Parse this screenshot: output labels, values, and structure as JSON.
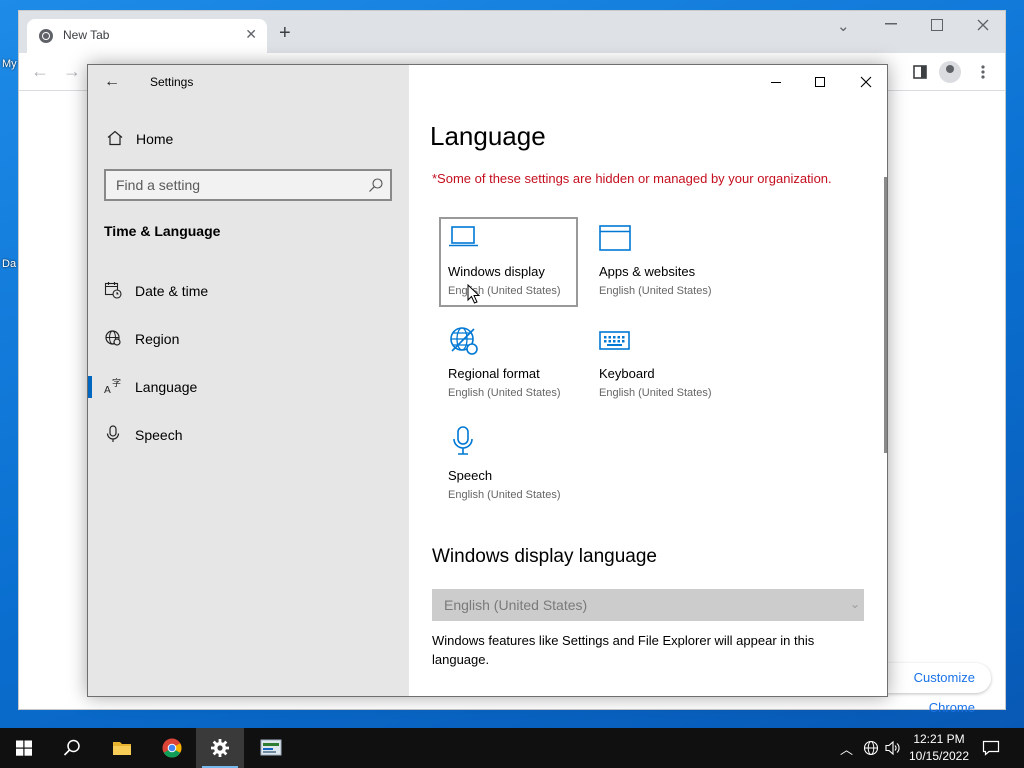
{
  "desktop": {
    "icon_label_1": "My",
    "icon_label_2": "Da"
  },
  "chrome": {
    "tab_title": "New Tab",
    "tab_close": "✕",
    "new_tab": "+",
    "minimize": "⌄",
    "customize_label": "Customize Chrome"
  },
  "settings": {
    "window_title": "Settings",
    "home_label": "Home",
    "search_placeholder": "Find a setting",
    "section_title": "Time & Language",
    "nav": [
      {
        "label": "Date & time",
        "icon": "calendar-clock-icon"
      },
      {
        "label": "Region",
        "icon": "globe-icon"
      },
      {
        "label": "Language",
        "icon": "language-icon",
        "active": true
      },
      {
        "label": "Speech",
        "icon": "microphone-icon"
      }
    ],
    "page_title": "Language",
    "org_note": "*Some of these settings are hidden or managed by your organization.",
    "tiles": [
      {
        "name": "Windows display",
        "sub": "English (United States)",
        "icon": "laptop-icon",
        "selected": true
      },
      {
        "name": "Apps & websites",
        "sub": "English (United States)",
        "icon": "window-icon"
      },
      {
        "name": "Regional format",
        "sub": "English (United States)",
        "icon": "regional-format-icon"
      },
      {
        "name": "Keyboard",
        "sub": "English (United States)",
        "icon": "keyboard-icon"
      },
      {
        "name": "Speech",
        "sub": "English (United States)",
        "icon": "microphone-icon"
      }
    ],
    "display_language_heading": "Windows display language",
    "display_language_value": "English (United States)",
    "display_language_desc": "Windows features like Settings and File Explorer will appear in this language."
  },
  "taskbar": {
    "time": "12:21 PM",
    "date": "10/15/2022"
  },
  "colors": {
    "accent": "#0067c0",
    "warning": "#c50f1f",
    "tile_icon": "#0078d4"
  }
}
